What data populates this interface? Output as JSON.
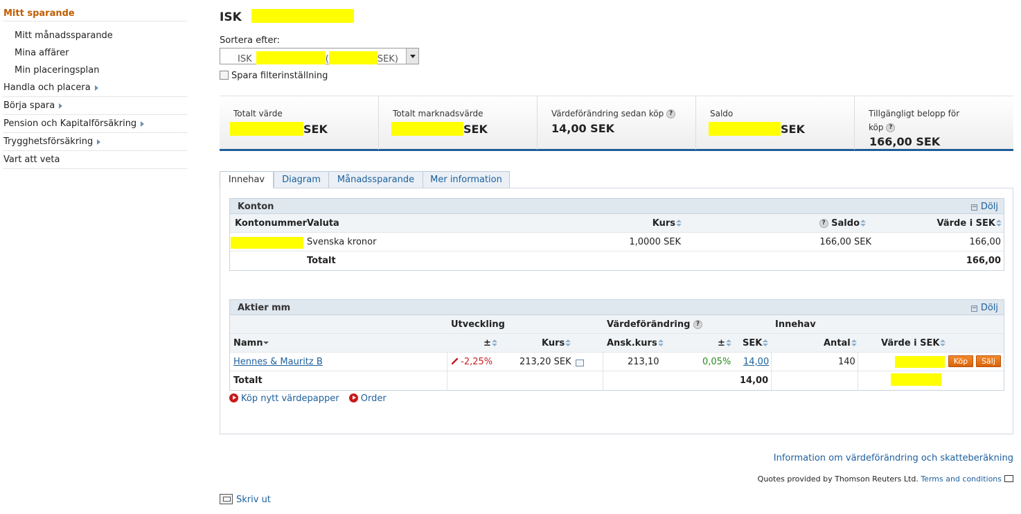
{
  "sidebar": {
    "header": "Mitt sparande",
    "sub_items": [
      "Mitt månadssparande",
      "Mina affärer",
      "Min placeringsplan"
    ],
    "items": [
      "Handla och placera",
      "Börja spara",
      "Pension och Kapitalförsäkring",
      "Trygghetsförsäkring",
      "Vart att veta"
    ]
  },
  "page": {
    "title": "ISK",
    "sort_label": "Sortera efter:",
    "select_prefix": "ISK",
    "select_mid": "(",
    "select_suffix": "SEK)",
    "filter_label": "Spara filterinställning"
  },
  "summary": {
    "total_value_label": "Totalt värde",
    "total_value_unit": "SEK",
    "market_value_label": "Totalt marknadsvärde",
    "market_value_unit": "SEK",
    "change_label": "Värdeförändring sedan köp",
    "change_value": "14,00 SEK",
    "saldo_label": "Saldo",
    "saldo_unit": "SEK",
    "available_label_1": "Tillgängligt belopp för",
    "available_label_2": "köp",
    "available_value": "166,00 SEK"
  },
  "tabs": [
    "Innehav",
    "Diagram",
    "Månadssparande",
    "Mer information"
  ],
  "konton": {
    "title": "Konton",
    "hide": "Dölj",
    "headers": [
      "Kontonummer",
      "Valuta",
      "Kurs",
      "Saldo",
      "Värde i SEK"
    ],
    "row": {
      "valuta": "Svenska kronor",
      "kurs": "1,0000 SEK",
      "saldo": "166,00 SEK",
      "varde": "166,00"
    },
    "total_label": "Totalt",
    "total_value": "166,00"
  },
  "aktier": {
    "title": "Aktier mm",
    "hide": "Dölj",
    "groups": [
      "Utveckling",
      "Värdeförändring",
      "Innehav"
    ],
    "headers": [
      "Namn",
      "±",
      "Kurs",
      "Ansk.kurs",
      "±",
      "SEK",
      "Antal",
      "Värde i SEK"
    ],
    "row": {
      "name": "Hennes & Mauritz B",
      "dev": "-2,25%",
      "kurs": "213,20 SEK",
      "ansk": "213,10",
      "pm": "0,05%",
      "sek": "14,00",
      "antal": "140",
      "buy": "Köp",
      "sell": "Sälj"
    },
    "total_label": "Totalt",
    "total_sek": "14,00"
  },
  "actions": {
    "buy_new": "Köp nytt värdepapper",
    "order": "Order"
  },
  "footer": {
    "info_link": "Information om värdeförändring och skatteberäkning",
    "quotes": "Quotes provided by Thomson Reuters Ltd.",
    "terms": "Terms and conditions",
    "print": "Skriv ut"
  },
  "colors": {
    "accent": "#1f5c9a",
    "sidebar_header": "#c05d00",
    "link": "#1d5f9c",
    "negative": "#c82020",
    "positive": "#2a8a1e",
    "button": "#e7731b",
    "redaction": "#ffff00"
  }
}
